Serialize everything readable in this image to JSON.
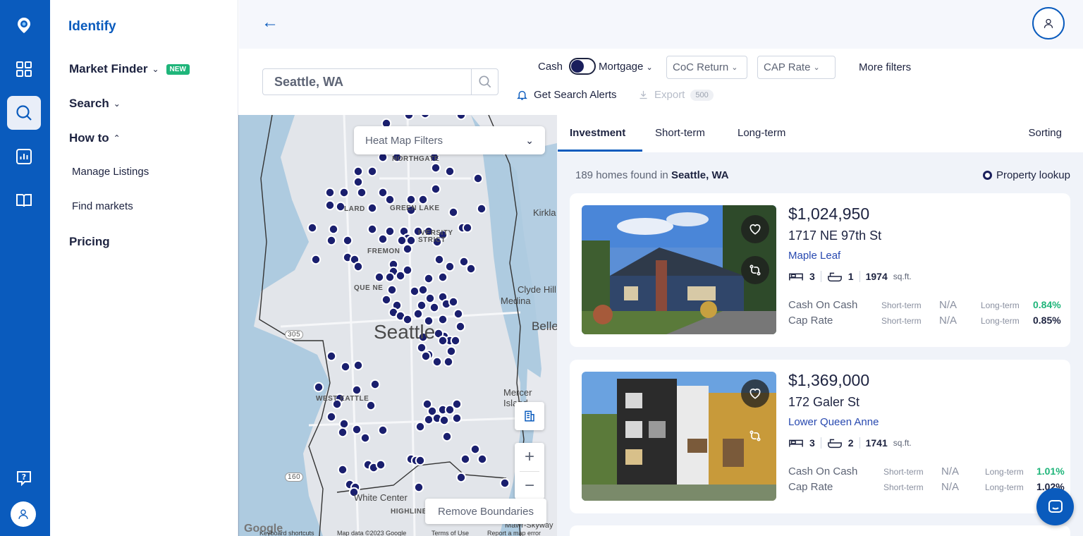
{
  "sidebar": {
    "brand": "Identify",
    "market_finder": "Market Finder",
    "new_badge": "NEW",
    "search": "Search",
    "how_to": "How to",
    "manage_listings": "Manage Listings",
    "find_markets": "Find markets",
    "pricing": "Pricing"
  },
  "filters": {
    "search_value": "Seattle, WA",
    "cash_label": "Cash",
    "mortgage_label": "Mortgage",
    "coc_return": "CoC Return",
    "cap_rate": "CAP Rate",
    "more_filters": "More filters",
    "get_alerts": "Get Search Alerts",
    "export": "Export",
    "export_count": "500"
  },
  "map": {
    "heat_map_filters": "Heat Map Filters",
    "remove_boundaries": "Remove Boundaries",
    "city": "Seattle",
    "labels": {
      "northgate": "NORTHGATE",
      "ballard": "LARD",
      "green_lake": "GREEN LAKE",
      "university": "IVERSITY",
      "district": "STRICT",
      "fremont": "FREMON",
      "queen_anne": "QUE   NE",
      "west_seattle": "WEST   EATTLE",
      "highline": "HIGHLINE",
      "kirkland": "Kirkla",
      "clyde_hill": "Clyde Hill",
      "medina": "Medina",
      "bellevue": "Belle",
      "mercer_island": "Mercer Island",
      "white_center": "White Center",
      "mawr_skyway": "Mawr-Skyway",
      "route_305": "305",
      "route_160": "160"
    },
    "footer": {
      "google": "Google",
      "shortcuts": "Keyboard shortcuts",
      "map_data": "Map data ©2023 Google",
      "terms": "Terms of Use",
      "report": "Report a map error"
    }
  },
  "panel": {
    "tabs": [
      "Investment",
      "Short-term",
      "Long-term"
    ],
    "sorting": "Sorting",
    "found_count": "189 homes found in",
    "found_location": "Seattle, WA",
    "property_lookup": "Property lookup"
  },
  "listings": [
    {
      "price": "$1,024,950",
      "address": "1717 NE 97th St",
      "neighborhood": "Maple Leaf",
      "beds": "3",
      "baths": "1",
      "sqft": "1974",
      "sqft_unit": "sq.ft.",
      "coc_label": "Cash On Cash",
      "cap_label": "Cap Rate",
      "short_term": "Short-term",
      "long_term": "Long-term",
      "coc_short": "N/A",
      "coc_long": "0.84%",
      "cap_short": "N/A",
      "cap_long": "0.85%"
    },
    {
      "price": "$1,369,000",
      "address": "172 Galer St",
      "neighborhood": "Lower Queen Anne",
      "beds": "3",
      "baths": "2",
      "sqft": "1741",
      "sqft_unit": "sq.ft.",
      "coc_label": "Cash On Cash",
      "cap_label": "Cap Rate",
      "short_term": "Short-term",
      "long_term": "Long-term",
      "coc_short": "N/A",
      "coc_long": "1.01%",
      "cap_short": "N/A",
      "cap_long": "1.02%"
    }
  ],
  "colors": {
    "brand_blue": "#0a5bbd",
    "accent_green": "#1fb57a",
    "marker_navy": "#1a1f6e"
  }
}
